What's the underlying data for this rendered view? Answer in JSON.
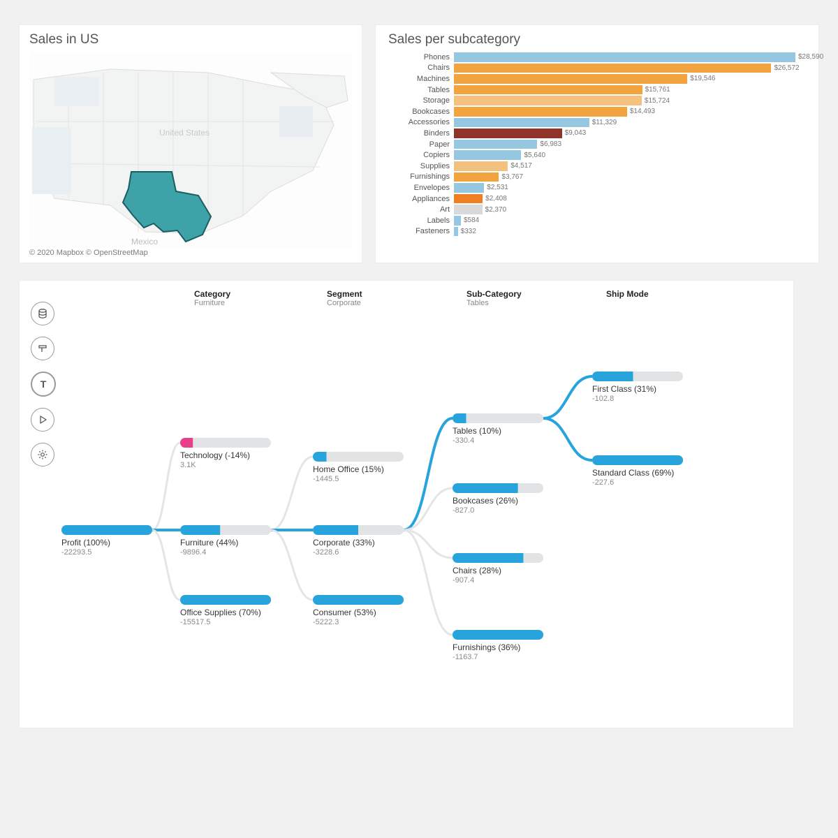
{
  "map": {
    "title": "Sales in US",
    "country_label": "United States",
    "neighbour_label": "Mexico",
    "highlight_state": "Texas",
    "attribution": "© 2020 Mapbox © OpenStreetMap"
  },
  "chart_data": {
    "type": "bar",
    "title": "Sales per subcategory",
    "orientation": "horizontal",
    "xlabel": "",
    "ylabel": "",
    "xlim": [
      0,
      29000
    ],
    "value_prefix": "$",
    "categories": [
      "Phones",
      "Chairs",
      "Machines",
      "Tables",
      "Storage",
      "Bookcases",
      "Accessories",
      "Binders",
      "Paper",
      "Copiers",
      "Supplies",
      "Furnishings",
      "Envelopes",
      "Appliances",
      "Art",
      "Labels",
      "Fasteners"
    ],
    "values": [
      28590,
      26572,
      19546,
      15761,
      15724,
      14493,
      11329,
      9043,
      6983,
      5640,
      4517,
      3767,
      2531,
      2408,
      2370,
      584,
      332
    ],
    "value_labels": [
      "$28,590",
      "$26,572",
      "$19,546",
      "$15,761",
      "$15,724",
      "$14,493",
      "$11,329",
      "$9,043",
      "$6,983",
      "$5,640",
      "$4,517",
      "$3,767",
      "$2,531",
      "$2,408",
      "$2,370",
      "$584",
      "$332"
    ],
    "colors": [
      "#96c7e0",
      "#f0a33f",
      "#f0a33f",
      "#f0a33f",
      "#f3c07e",
      "#f0a33f",
      "#96c7e0",
      "#8f342a",
      "#96c7e0",
      "#96c7e0",
      "#f3c07e",
      "#f0a33f",
      "#96c7e0",
      "#ef7f22",
      "#d7d9da",
      "#96c7e0",
      "#96c7e0"
    ]
  },
  "tree": {
    "headers": [
      {
        "title": "Category",
        "sub": "Furniture"
      },
      {
        "title": "Segment",
        "sub": "Corporate"
      },
      {
        "title": "Sub-Category",
        "sub": "Tables"
      },
      {
        "title": "Ship Mode",
        "sub": ""
      }
    ],
    "root": {
      "label": "Profit (100%)",
      "sub": "-22293.5",
      "fill": 1.0
    },
    "level1": [
      {
        "label": "Technology (-14%)",
        "sub": "3.1K",
        "fill": 0.14,
        "fillColor": "#e83e8c",
        "selected": false
      },
      {
        "label": "Furniture (44%)",
        "sub": "-9896.4",
        "fill": 0.44,
        "selected": true
      },
      {
        "label": "Office Supplies (70%)",
        "sub": "-15517.5",
        "fill": 1.0,
        "selected": false
      }
    ],
    "level2": [
      {
        "label": "Home Office (15%)",
        "sub": "-1445.5",
        "fill": 0.15
      },
      {
        "label": "Corporate (33%)",
        "sub": "-3228.6",
        "fill": 0.5,
        "selected": true
      },
      {
        "label": "Consumer (53%)",
        "sub": "-5222.3",
        "fill": 1.0
      }
    ],
    "level3": [
      {
        "label": "Tables (10%)",
        "sub": "-330.4",
        "fill": 0.15,
        "selected": true
      },
      {
        "label": "Bookcases (26%)",
        "sub": "-827.0",
        "fill": 0.72
      },
      {
        "label": "Chairs (28%)",
        "sub": "-907.4",
        "fill": 0.78
      },
      {
        "label": "Furnishings (36%)",
        "sub": "-1163.7",
        "fill": 1.0
      }
    ],
    "level4": [
      {
        "label": "First Class (31%)",
        "sub": "-102.8",
        "fill": 0.45
      },
      {
        "label": "Standard Class (69%)",
        "sub": "-227.6",
        "fill": 1.0
      }
    ],
    "toolbar_icons": [
      "data-icon",
      "format-icon",
      "text-icon",
      "play-icon",
      "gear-icon"
    ]
  }
}
